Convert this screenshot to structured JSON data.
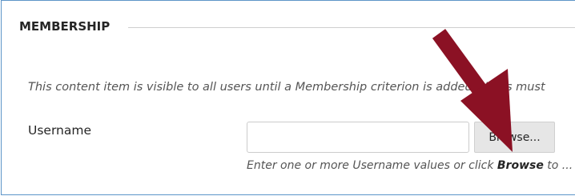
{
  "section": {
    "title": "MEMBERSHIP"
  },
  "intro_text": "This content item is visible to all users until a Membership criterion is added. Users must",
  "username_field": {
    "label": "Username",
    "value": "",
    "placeholder": ""
  },
  "browse_button": {
    "label": "Browse..."
  },
  "help": {
    "prefix": "Enter one or more Username values or click ",
    "emphasis": "Browse",
    "suffix": " to ..."
  },
  "colors": {
    "frame_border": "#5d95c8",
    "arrow": "#8b1124",
    "button_bg": "#e6e6e6"
  },
  "annotation_icon": "red-arrow-icon"
}
